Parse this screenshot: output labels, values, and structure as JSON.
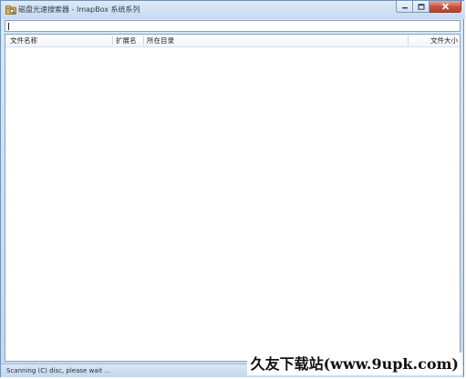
{
  "window": {
    "title": "磁盘光速搜索器 - ImapBox 系统系列",
    "controls": {
      "minimize_icon": "minimize-icon",
      "maximize_icon": "maximize-icon",
      "close_icon": "close-icon"
    }
  },
  "search": {
    "value": "",
    "placeholder": ""
  },
  "list": {
    "columns": [
      {
        "label": "文件名称"
      },
      {
        "label": "扩展名"
      },
      {
        "label": "所在目录"
      },
      {
        "label": "文件大小"
      }
    ],
    "rows": []
  },
  "status": {
    "text": "Scanning (C) disc, please wait ..."
  },
  "watermark": {
    "text": "久友下载站(www.9upk.com)"
  },
  "colors": {
    "frame": "#c4d8ee",
    "close_button": "#c7523d",
    "border": "#8aa3c0"
  }
}
